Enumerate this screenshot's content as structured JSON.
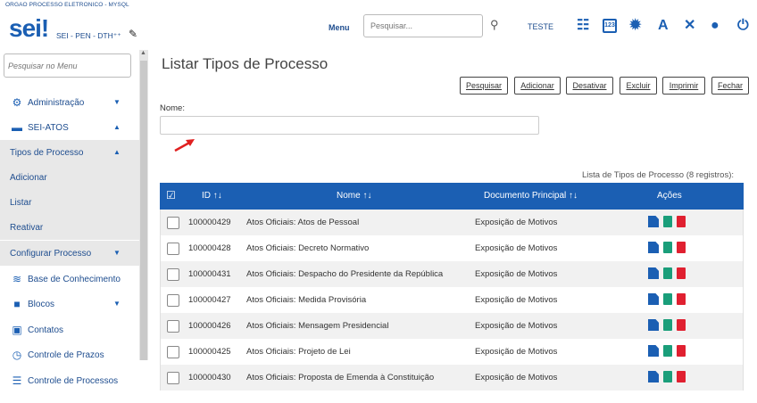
{
  "header": {
    "org": "ORGAO PROCESSO ELETRONICO - MYSQL",
    "logo": "sei!",
    "unit_path": "SEI - PEN - DTH⁺⁺",
    "menu_label": "Menu",
    "search_placeholder": "Pesquisar...",
    "unit_name": "TESTE"
  },
  "sidebar": {
    "search_placeholder": "Pesquisar no Menu",
    "items": [
      {
        "label": "Administração"
      },
      {
        "label": "SEI-ATOS"
      },
      {
        "label": "Tipos de Processo"
      },
      {
        "label": "Adicionar"
      },
      {
        "label": "Listar"
      },
      {
        "label": "Reativar"
      },
      {
        "label": "Configurar Processo"
      },
      {
        "label": "Base de Conhecimento"
      },
      {
        "label": "Blocos"
      },
      {
        "label": "Contatos"
      },
      {
        "label": "Controle de Prazos"
      },
      {
        "label": "Controle de Processos"
      }
    ]
  },
  "main": {
    "title": "Listar Tipos de Processo",
    "buttons": [
      "Pesquisar",
      "Adicionar",
      "Desativar",
      "Excluir",
      "Imprimir",
      "Fechar"
    ],
    "nome_label": "Nome:",
    "caption": "Lista de Tipos de Processo (8 registros):",
    "columns": {
      "id": "ID",
      "nome": "Nome",
      "documento": "Documento Principal",
      "acoes": "Ações"
    },
    "rows": [
      {
        "id": "100000429",
        "nome": "Atos Oficiais: Atos de Pessoal",
        "doc": "Exposição de Motivos"
      },
      {
        "id": "100000428",
        "nome": "Atos Oficiais: Decreto Normativo",
        "doc": "Exposição de Motivos"
      },
      {
        "id": "100000431",
        "nome": "Atos Oficiais: Despacho do Presidente da República",
        "doc": "Exposição de Motivos"
      },
      {
        "id": "100000427",
        "nome": "Atos Oficiais: Medida Provisória",
        "doc": "Exposição de Motivos"
      },
      {
        "id": "100000426",
        "nome": "Atos Oficiais: Mensagem Presidencial",
        "doc": "Exposição de Motivos"
      },
      {
        "id": "100000425",
        "nome": "Atos Oficiais: Projeto de Lei",
        "doc": "Exposição de Motivos"
      },
      {
        "id": "100000430",
        "nome": "Atos Oficiais: Proposta de Emenda à Constituição",
        "doc": "Exposição de Motivos"
      }
    ]
  },
  "colors": {
    "accent": "#1b5fb3",
    "header_bg": "#1b5fb3",
    "delete": "#e02030",
    "green": "#1a9e7a",
    "arrow": "#e02020"
  },
  "icons": [
    "search-icon",
    "list-icon",
    "calculator-icon",
    "alert-icon",
    "font-icon",
    "tools-icon",
    "user-icon",
    "power-icon"
  ]
}
